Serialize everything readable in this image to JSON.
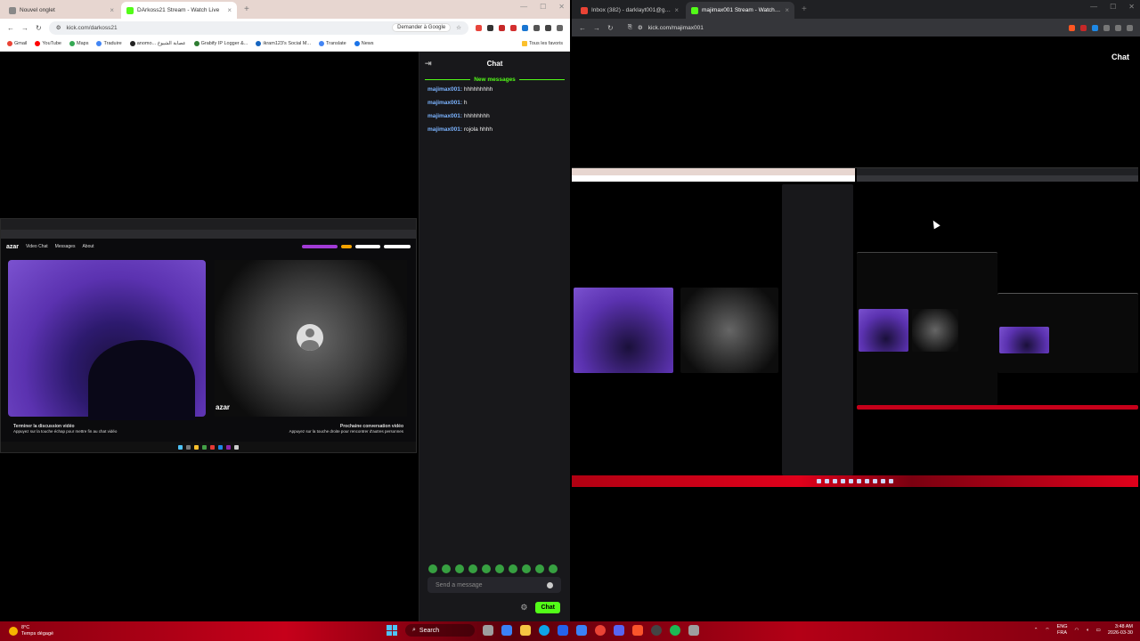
{
  "left_browser": {
    "tabs": [
      {
        "label": "Nouvel onglet",
        "active": false
      },
      {
        "label": "DArkoss21 Stream - Watch Live",
        "active": true
      }
    ],
    "url": "kick.com/darkoss21",
    "ask_google": "Demander à Google",
    "bookmarks": [
      "Gmail",
      "YouTube",
      "Maps",
      "Traduire",
      "anomo... عصابة الشيوخ",
      "Grabify IP Logger &...",
      "ikram123's Social M...",
      "Translate",
      "News"
    ],
    "all_favorites": "Tous les favoris"
  },
  "chat": {
    "title": "Chat",
    "new_messages_label": "New messages",
    "messages": [
      {
        "user": "majimax001:",
        "text": "hhhhhhhhh"
      },
      {
        "user": "majimax001:",
        "text": "h"
      },
      {
        "user": "majimax001:",
        "text": "hhhhhhhh"
      },
      {
        "user": "majimax001:",
        "text": "rojola hhhh"
      }
    ],
    "placeholder": "Send a message",
    "send_label": "Chat"
  },
  "azar": {
    "logo": "azar",
    "tabs": [
      "Video Chat",
      "Messages",
      "About"
    ],
    "watermark": "azar",
    "end_chat": "Terminer la discussion vidéo",
    "end_chat_hint": "Appuyez sur la touche échap pour mettre fin au chat vidéo",
    "next_chat": "Prochaine conversation vidéo",
    "next_chat_hint": "Appuyez sur la touche droite pour rencontrer d'autres personnes"
  },
  "right_browser": {
    "tabs": [
      {
        "label": "Inbox (382) - darklayt001@gmail.com",
        "active": false
      },
      {
        "label": "majimax001 Stream - Watch Live",
        "active": true
      }
    ],
    "url": "kick.com/majimax001",
    "chat_label": "Chat"
  },
  "taskbar": {
    "weather_temp": "8°C",
    "weather_desc": "Temps dégagé",
    "search_label": "Search",
    "lang_top": "ENG",
    "lang_bottom": "FRA",
    "time": "3:48 AM",
    "date": "2026-03-30"
  },
  "colors": {
    "kick_green": "#53fc18",
    "chat_user": "#7bb3ff",
    "taskbar_red": "#c6001a"
  }
}
